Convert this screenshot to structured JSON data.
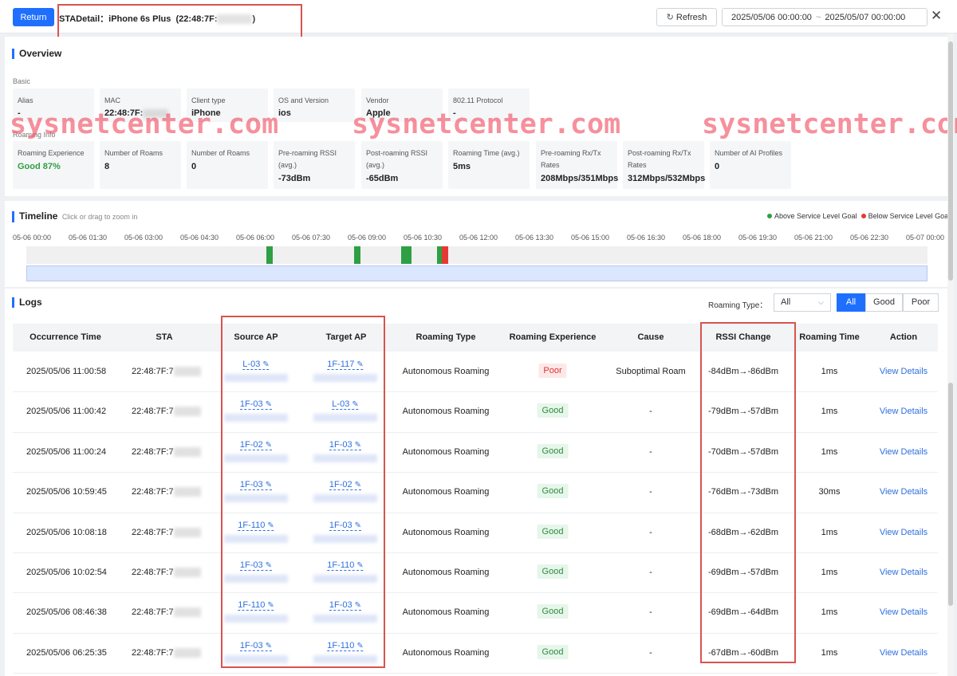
{
  "header": {
    "return_label": "Return",
    "sta_detail_prefix": "STADetail：",
    "device": "iPhone 6s Plus",
    "mac_visible": "(22:48:7F:",
    "mac_close": ")",
    "refresh_label": "Refresh",
    "date_from": "2025/05/06 00:00:00",
    "date_sep": "~",
    "date_to": "2025/05/07 00:00:00"
  },
  "overview": {
    "title": "Overview",
    "basic_label": "Basic",
    "roaming_info_label": "Roaming Info",
    "basic": [
      {
        "label": "Alias",
        "value": "-"
      },
      {
        "label": "MAC",
        "value": "22:48:7F:"
      },
      {
        "label": "Client type",
        "value": "iPhone"
      },
      {
        "label": "OS and Version",
        "value": "ios"
      },
      {
        "label": "Vendor",
        "value": "Apple"
      },
      {
        "label": "802.11 Protocol",
        "value": "-"
      }
    ],
    "roaming": [
      {
        "label": "Roaming Experience",
        "value": "Good 87%"
      },
      {
        "label": "Number of Roams",
        "value": "8"
      },
      {
        "label": "Number of Roams",
        "value": "0"
      },
      {
        "label": "Pre-roaming RSSI (avg.)",
        "value": "-73dBm"
      },
      {
        "label": "Post-roaming RSSI (avg.)",
        "value": "-65dBm"
      },
      {
        "label": "Roaming Time (avg.)",
        "value": "5ms"
      },
      {
        "label": "Pre-roaming Rx/Tx Rates",
        "value": "208Mbps/351Mbps"
      },
      {
        "label": "Post-roaming Rx/Tx Rates",
        "value": "312Mbps/532Mbps"
      },
      {
        "label": "Number of AI Profiles",
        "value": "0"
      }
    ]
  },
  "watermark": "sysnetcenter.com",
  "timeline": {
    "title": "Timeline",
    "hint": "Click or drag to zoom in",
    "legend_above": "Above Service Level Goal",
    "legend_below": "Below Service Level Goal",
    "color_above": "#2ea043",
    "color_below": "#e53935",
    "ticks": [
      "05-06 00:00",
      "05-06 01:30",
      "05-06 03:00",
      "05-06 04:30",
      "05-06 06:00",
      "05-06 07:30",
      "05-06 09:00",
      "05-06 10:30",
      "05-06 12:00",
      "05-06 13:30",
      "05-06 15:00",
      "05-06 16:30",
      "05-06 18:00",
      "05-06 19:30",
      "05-06 21:00",
      "05-06 22:30",
      "05-07 00:00"
    ],
    "events": [
      {
        "time": "06:25",
        "status": "above"
      },
      {
        "time": "08:46",
        "status": "above"
      },
      {
        "time": "10:02",
        "status": "above"
      },
      {
        "time": "10:08",
        "status": "above"
      },
      {
        "time": "10:59",
        "status": "above"
      },
      {
        "time": "11:00",
        "status": "above"
      },
      {
        "time": "11:00",
        "status": "above"
      },
      {
        "time": "11:00",
        "status": "below"
      }
    ]
  },
  "logs": {
    "title": "Logs",
    "roaming_type_label": "Roaming Type：",
    "roaming_type_value": "All",
    "filters": [
      "All",
      "Good",
      "Poor"
    ],
    "columns": [
      "Occurrence Time",
      "STA",
      "Source AP",
      "Target AP",
      "Roaming Type",
      "Roaming Experience",
      "Cause",
      "RSSI Change",
      "Roaming Time",
      "Action"
    ],
    "rows": [
      {
        "time": "2025/05/06 11:00:58",
        "sta": "22:48:7F:7",
        "source": "L-03",
        "target": "1F-117",
        "type": "Autonomous Roaming",
        "exp": "Poor",
        "cause": "Suboptimal Roam",
        "rssi": "-84dBm→-86dBm",
        "rtime": "1ms",
        "action": "View Details"
      },
      {
        "time": "2025/05/06 11:00:42",
        "sta": "22:48:7F:7",
        "source": "1F-03",
        "target": "L-03",
        "type": "Autonomous Roaming",
        "exp": "Good",
        "cause": "-",
        "rssi": "-79dBm→-57dBm",
        "rtime": "1ms",
        "action": "View Details"
      },
      {
        "time": "2025/05/06 11:00:24",
        "sta": "22:48:7F:7",
        "source": "1F-02",
        "target": "1F-03",
        "type": "Autonomous Roaming",
        "exp": "Good",
        "cause": "-",
        "rssi": "-70dBm→-57dBm",
        "rtime": "1ms",
        "action": "View Details"
      },
      {
        "time": "2025/05/06 10:59:45",
        "sta": "22:48:7F:7",
        "source": "1F-03",
        "target": "1F-02",
        "type": "Autonomous Roaming",
        "exp": "Good",
        "cause": "-",
        "rssi": "-76dBm→-73dBm",
        "rtime": "30ms",
        "action": "View Details"
      },
      {
        "time": "2025/05/06 10:08:18",
        "sta": "22:48:7F:7",
        "source": "1F-110",
        "target": "1F-03",
        "type": "Autonomous Roaming",
        "exp": "Good",
        "cause": "-",
        "rssi": "-68dBm→-62dBm",
        "rtime": "1ms",
        "action": "View Details"
      },
      {
        "time": "2025/05/06 10:02:54",
        "sta": "22:48:7F:7",
        "source": "1F-03",
        "target": "1F-110",
        "type": "Autonomous Roaming",
        "exp": "Good",
        "cause": "-",
        "rssi": "-69dBm→-57dBm",
        "rtime": "1ms",
        "action": "View Details"
      },
      {
        "time": "2025/05/06 08:46:38",
        "sta": "22:48:7F:7",
        "source": "1F-110",
        "target": "1F-03",
        "type": "Autonomous Roaming",
        "exp": "Good",
        "cause": "-",
        "rssi": "-69dBm→-64dBm",
        "rtime": "1ms",
        "action": "View Details"
      },
      {
        "time": "2025/05/06 06:25:35",
        "sta": "22:48:7F:7",
        "source": "1F-03",
        "target": "1F-110",
        "type": "Autonomous Roaming",
        "exp": "Good",
        "cause": "-",
        "rssi": "-67dBm→-60dBm",
        "rtime": "1ms",
        "action": "View Details"
      }
    ]
  },
  "icons": {
    "refresh": "refresh-icon",
    "close": "close-icon",
    "chevron": "chevron-down-icon",
    "edit": "pencil-icon"
  },
  "colors": {
    "accent": "#1f6fff",
    "link": "#2f6fe0",
    "good": "#2e8b3e",
    "poor": "#d33",
    "annotation": "#d9534f"
  }
}
